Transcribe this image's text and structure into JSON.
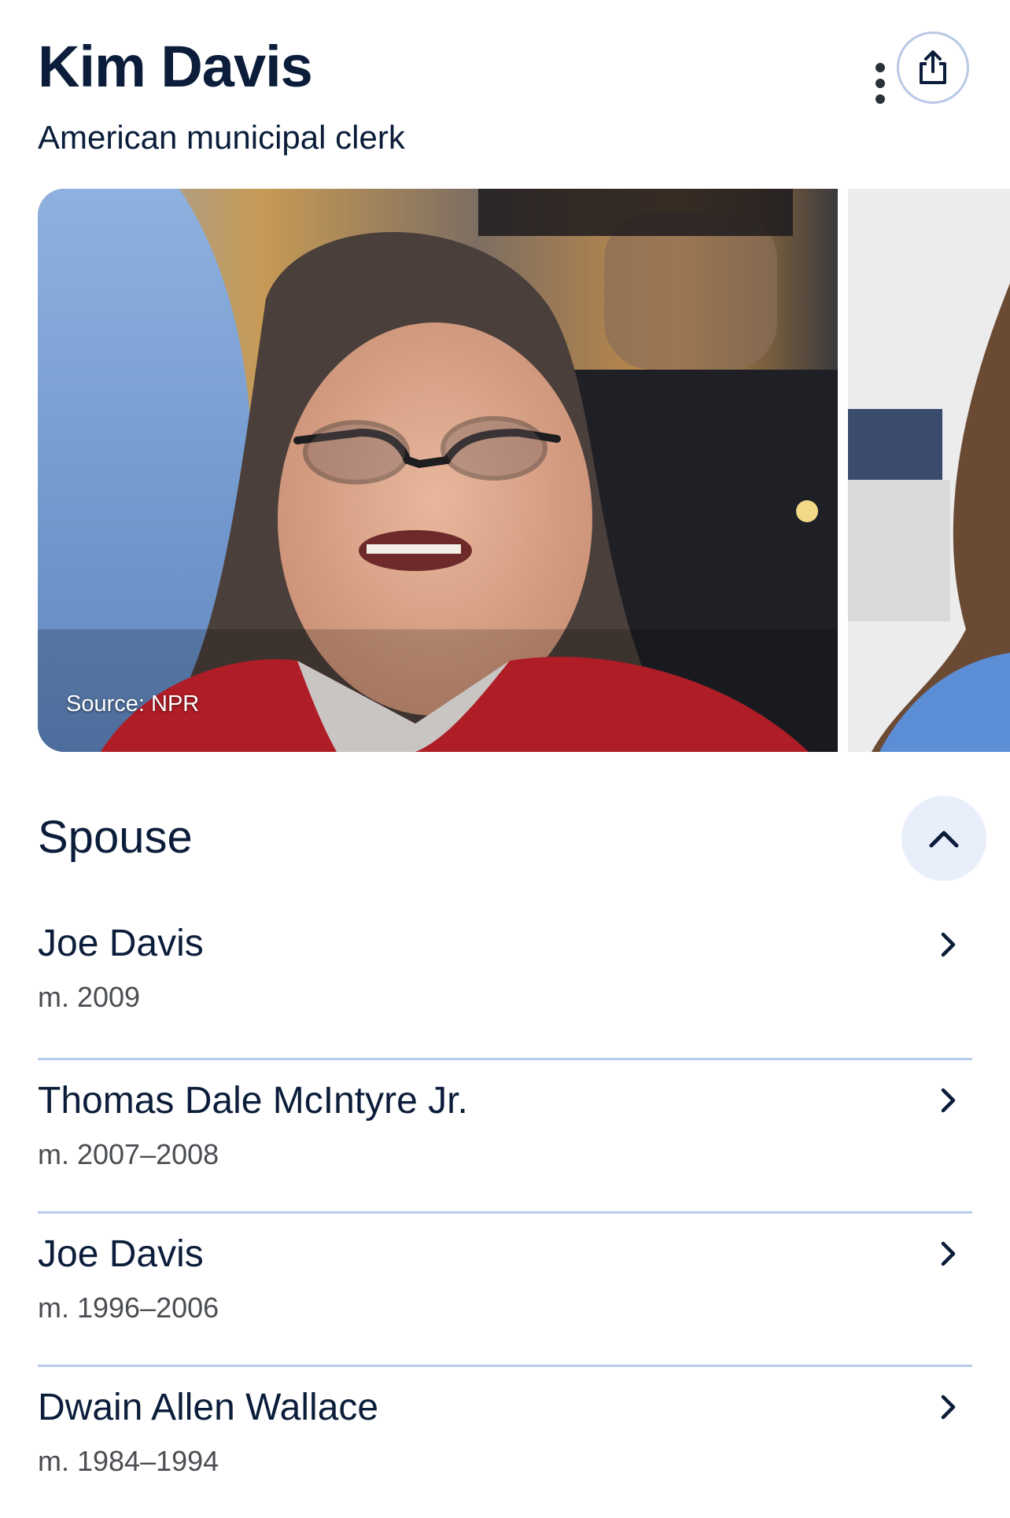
{
  "header": {
    "title": "Kim Davis",
    "subtitle": "American municipal clerk",
    "more_icon": "more-vert-icon",
    "share_icon": "share-icon"
  },
  "images": {
    "main_credit": "Source: NPR"
  },
  "spouse": {
    "title": "Spouse",
    "collapse_icon": "chevron-up-icon",
    "items": [
      {
        "name": "Joe Davis",
        "dates": "m. 2009"
      },
      {
        "name": "Thomas Dale McIntyre Jr.",
        "dates": "m. 2007–2008"
      },
      {
        "name": "Joe Davis",
        "dates": "m. 1996–2006"
      },
      {
        "name": "Dwain Allen Wallace",
        "dates": "m. 1984–1994"
      }
    ]
  },
  "colors": {
    "title": "#0b1d3a",
    "divider": "#b9cbea",
    "collapse_bg": "#e9eefb",
    "share_border": "#b9c8e6"
  }
}
